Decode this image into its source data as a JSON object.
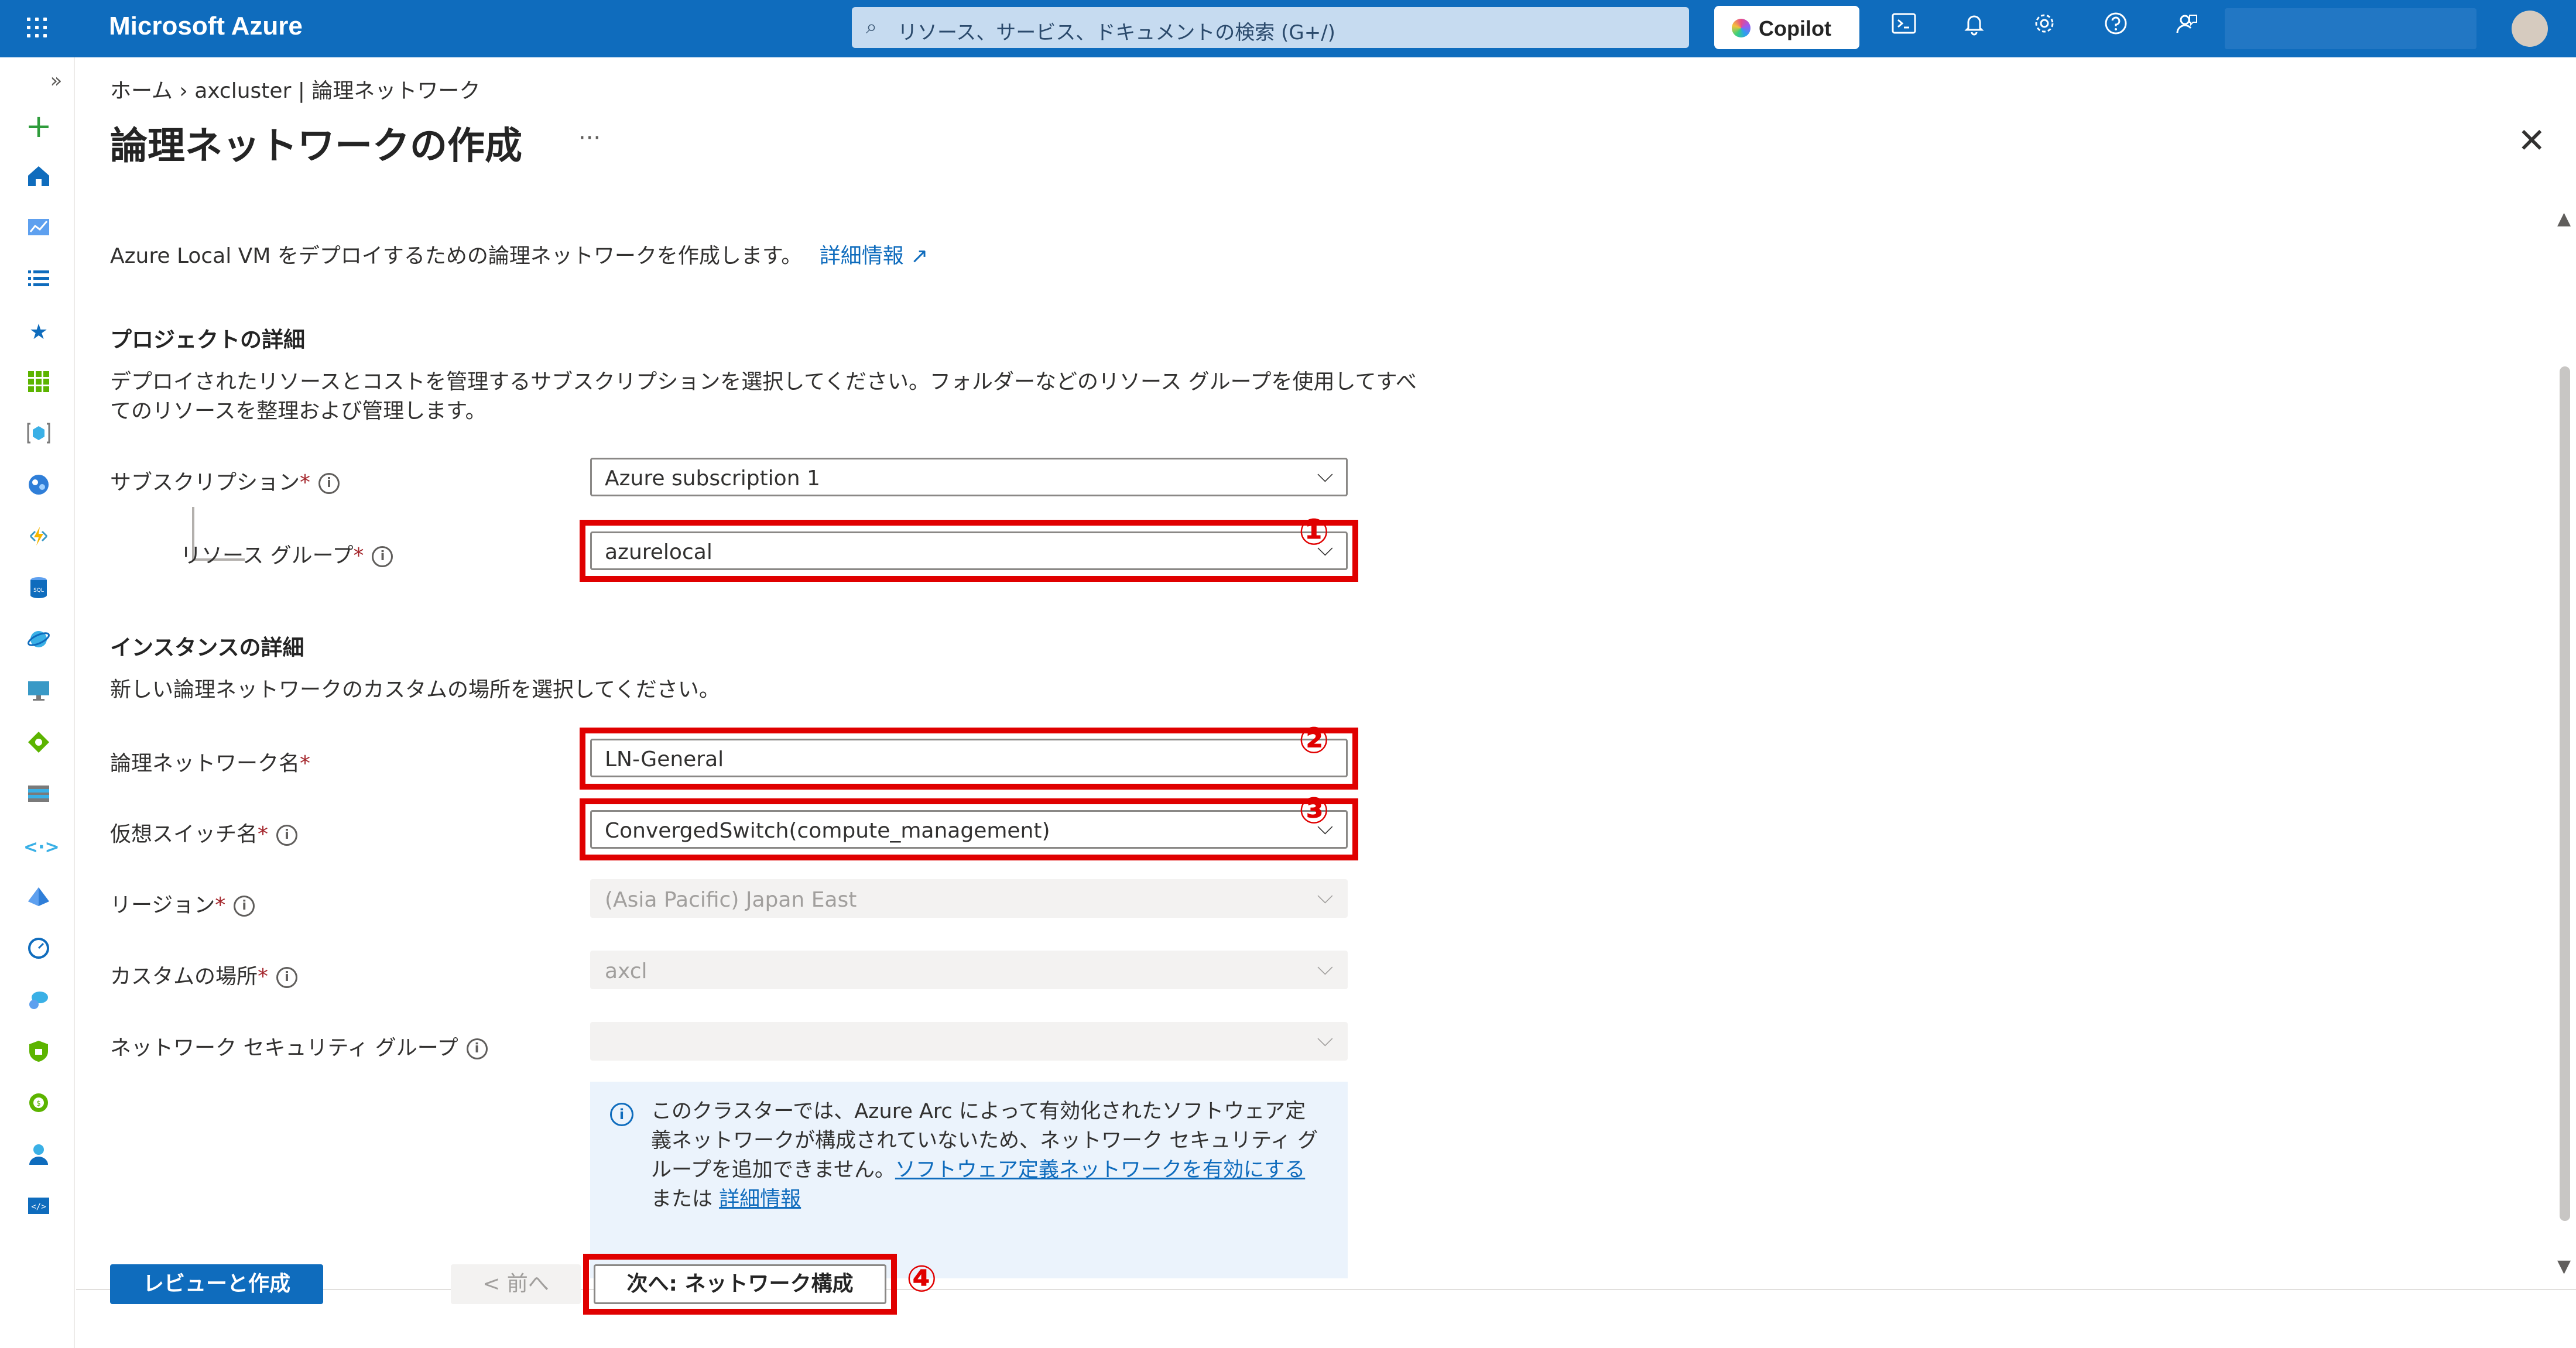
{
  "topbar": {
    "brand": "Microsoft Azure",
    "search_placeholder": "リソース、サービス、ドキュメントの検索 (G+/)",
    "copilot_label": "Copilot"
  },
  "breadcrumb": "ホーム  ›  axcluster | 論理ネットワーク",
  "page": {
    "title": "論理ネットワークの作成",
    "more": "···",
    "description": "Azure Local VM をデプロイするための論理ネットワークを作成します。",
    "learn_more": "詳細情報 ↗"
  },
  "project": {
    "heading": "プロジェクトの詳細",
    "desc_line1": "デプロイされたリソースとコストを管理するサブスクリプションを選択してください。フォルダーなどのリソース グループを使用してすべ",
    "desc_line2": "てのリソースを整理および管理します。",
    "subscription_label": "サブスクリプション",
    "subscription_value": "Azure subscription 1",
    "rg_label": "リソース グループ",
    "rg_value": "azurelocal"
  },
  "instance": {
    "heading": "インスタンスの詳細",
    "desc": "新しい論理ネットワークのカスタムの場所を選択してください。",
    "name_label": "論理ネットワーク名",
    "name_value": "LN-General",
    "switch_label": "仮想スイッチ名",
    "switch_value": "ConvergedSwitch(compute_management)",
    "region_label": "リージョン",
    "region_value": "(Asia Pacific) Japan East",
    "custom_label": "カスタムの場所",
    "custom_value": "axcl",
    "nsg_label": "ネットワーク セキュリティ グループ",
    "nsg_value": ""
  },
  "notice": {
    "text": "このクラスターでは、Azure Arc によって有効化されたソフトウェア定義ネットワークが構成されていないため、ネットワーク セキュリティ グループを追加できません。",
    "link1": "ソフトウェア定義ネットワークを有効にする",
    "mid": " または ",
    "link2": "詳細情報"
  },
  "footer": {
    "review_create": "レビューと作成",
    "prev": "< 前へ",
    "next": "次へ: ネットワーク構成"
  },
  "annotations": [
    "①",
    "②",
    "③",
    "④"
  ],
  "colors": {
    "accent": "#0f6cbd",
    "highlight": "#e00000"
  },
  "required_mark": "*",
  "chevron": "⌵",
  "close": "✕"
}
